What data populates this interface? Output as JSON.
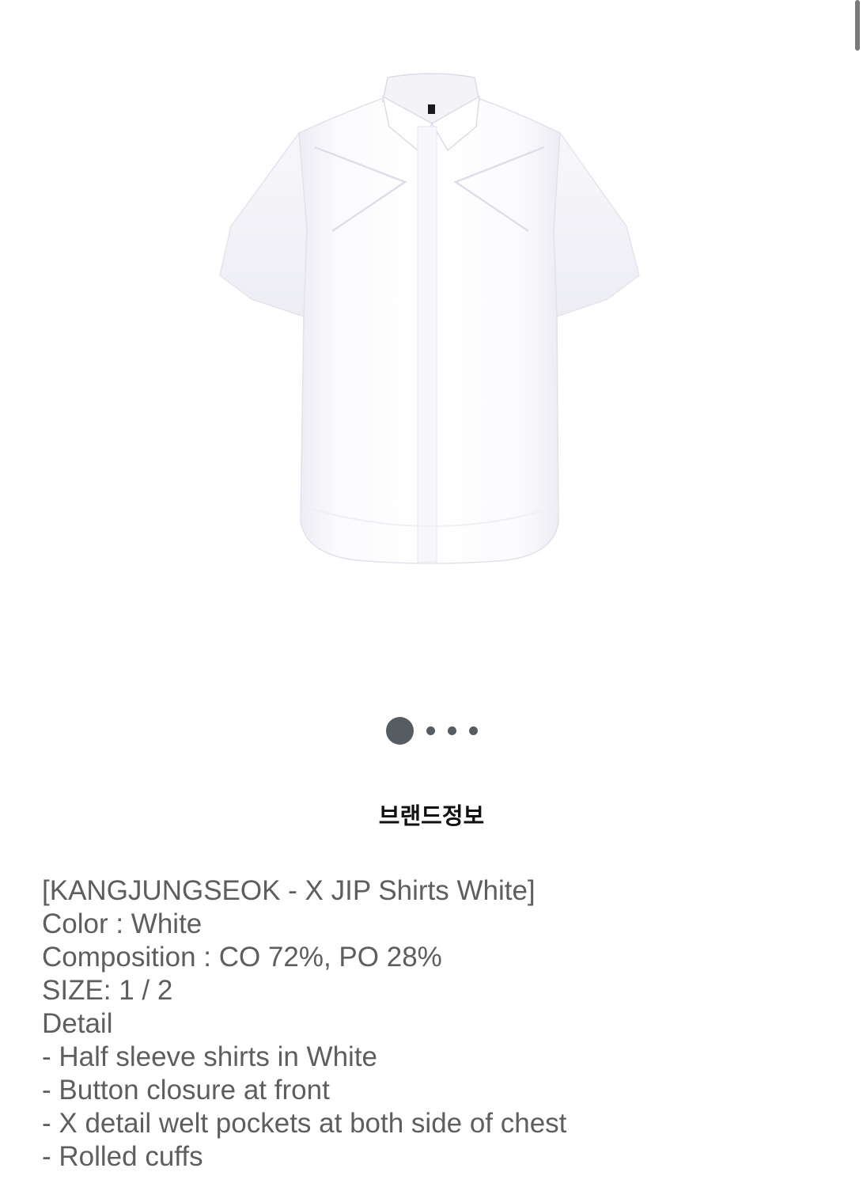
{
  "product": {
    "image_alt": "White short-sleeve shirt with X detail welt pockets",
    "brand_info_label": "브랜드정보",
    "carousel": {
      "total": 4,
      "active_index": 0
    },
    "description": {
      "title_line": "[KANGJUNGSEOK - X JIP Shirts White]",
      "color_line": "Color : White",
      "composition_line": "Composition : CO 72%, PO 28%",
      "size_line": "SIZE: 1 / 2",
      "detail_heading": "Detail",
      "details": [
        "- Half sleeve shirts in White",
        "- Button closure at front",
        "- X detail welt pockets at both side of chest",
        "- Rolled cuffs"
      ]
    }
  },
  "colors": {
    "dot": "#575c61",
    "text": "#5e5e5e",
    "heading": "#111111"
  }
}
